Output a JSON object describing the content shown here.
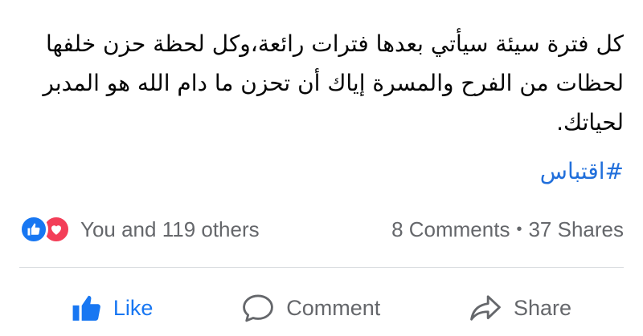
{
  "post": {
    "text": "كل فترة سيئة سيأتي بعدها فترات رائعة،وكل لحظة حزن خلفها لحظات من الفرح والمسرة إياك أن تحزن ما دام الله هو المدبر لحياتك.",
    "hashtag": "#اقتباس"
  },
  "reactions": {
    "summary": "You and 119 others",
    "icons": [
      "like-icon",
      "love-icon"
    ]
  },
  "stats": {
    "comments": "8 Comments",
    "separator": "•",
    "shares": "37 Shares"
  },
  "actions": {
    "like_label": "Like",
    "comment_label": "Comment",
    "share_label": "Share"
  },
  "colors": {
    "like_blue": "#1877f2",
    "love_red": "#f33e58",
    "hashtag_blue": "#216fdb",
    "secondary_text": "#65676b",
    "divider": "#dadde1"
  }
}
